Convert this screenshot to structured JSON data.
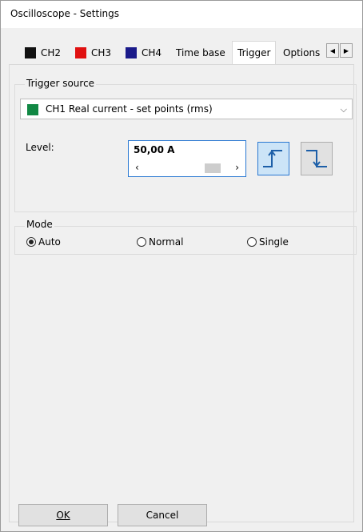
{
  "window": {
    "title": "Oscilloscope - Settings"
  },
  "tabs": [
    {
      "label": "CH2",
      "swatch": "#111111"
    },
    {
      "label": "CH3",
      "swatch": "#e01010"
    },
    {
      "label": "CH4",
      "swatch": "#1a1a8a"
    },
    {
      "label": "Time base"
    },
    {
      "label": "Trigger",
      "active": true
    },
    {
      "label": "Options"
    }
  ],
  "trigger_source": {
    "legend": "Trigger source",
    "selected": "CH1 Real current - set points (rms)",
    "swatch": "#118844"
  },
  "level": {
    "label": "Level:",
    "value": "50,00 A"
  },
  "mode": {
    "legend": "Mode",
    "options": [
      {
        "label": "Auto",
        "checked": true
      },
      {
        "label": "Normal",
        "checked": false
      },
      {
        "label": "Single",
        "checked": false
      }
    ]
  },
  "buttons": {
    "ok": "OK",
    "cancel": "Cancel"
  },
  "colors": {
    "accent": "#2a78d2",
    "edge_icon": "#1d5fa8"
  }
}
